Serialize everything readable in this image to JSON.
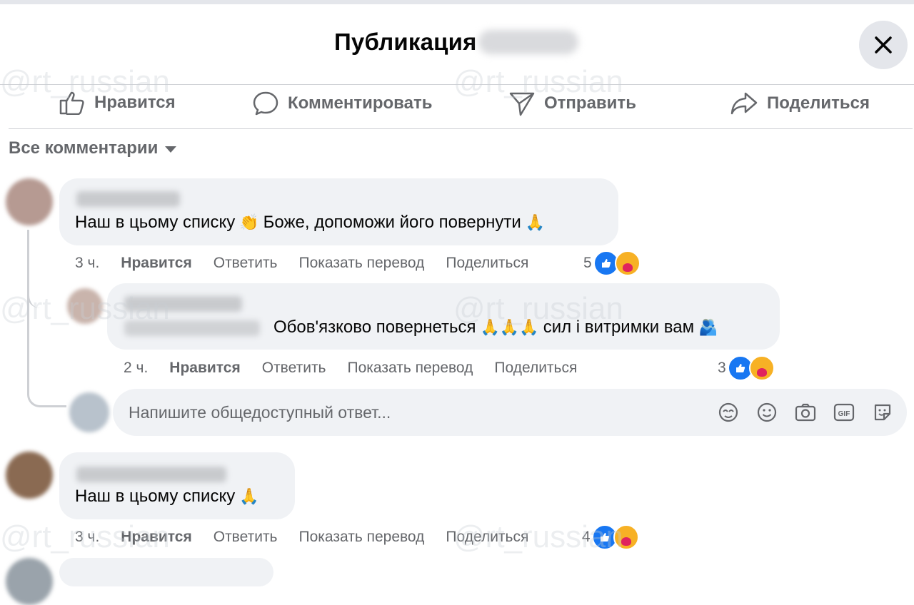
{
  "header": {
    "title": "Публикация"
  },
  "actions": {
    "like": "Нравится",
    "comment": "Комментировать",
    "send": "Отправить",
    "share": "Поделиться"
  },
  "filter": {
    "label": "Все комментарии"
  },
  "comments": [
    {
      "text": "Наш в цьому списку",
      "text2": "Боже, допоможи його повернути",
      "time": "3 ч.",
      "like": "Нравится",
      "reply": "Ответить",
      "translate": "Показать перевод",
      "share": "Поделиться",
      "reactions": "5"
    },
    {
      "text": "Обов'язково повернеться",
      "text2": "сил і витримки вам",
      "time": "2 ч.",
      "like": "Нравится",
      "reply": "Ответить",
      "translate": "Показать перевод",
      "share": "Поделиться",
      "reactions": "3"
    },
    {
      "text": "Наш в цьому списку",
      "time": "3 ч.",
      "like": "Нравится",
      "reply": "Ответить",
      "translate": "Показать перевод",
      "share": "Поделиться",
      "reactions": "4"
    }
  ],
  "reply_box": {
    "placeholder": "Напишите общедоступный ответ..."
  },
  "watermark": "@rt_russian",
  "colors": {
    "accent": "#1877f2",
    "muted": "#65676b",
    "bubble": "#f0f2f5",
    "care": "#f7b125"
  }
}
